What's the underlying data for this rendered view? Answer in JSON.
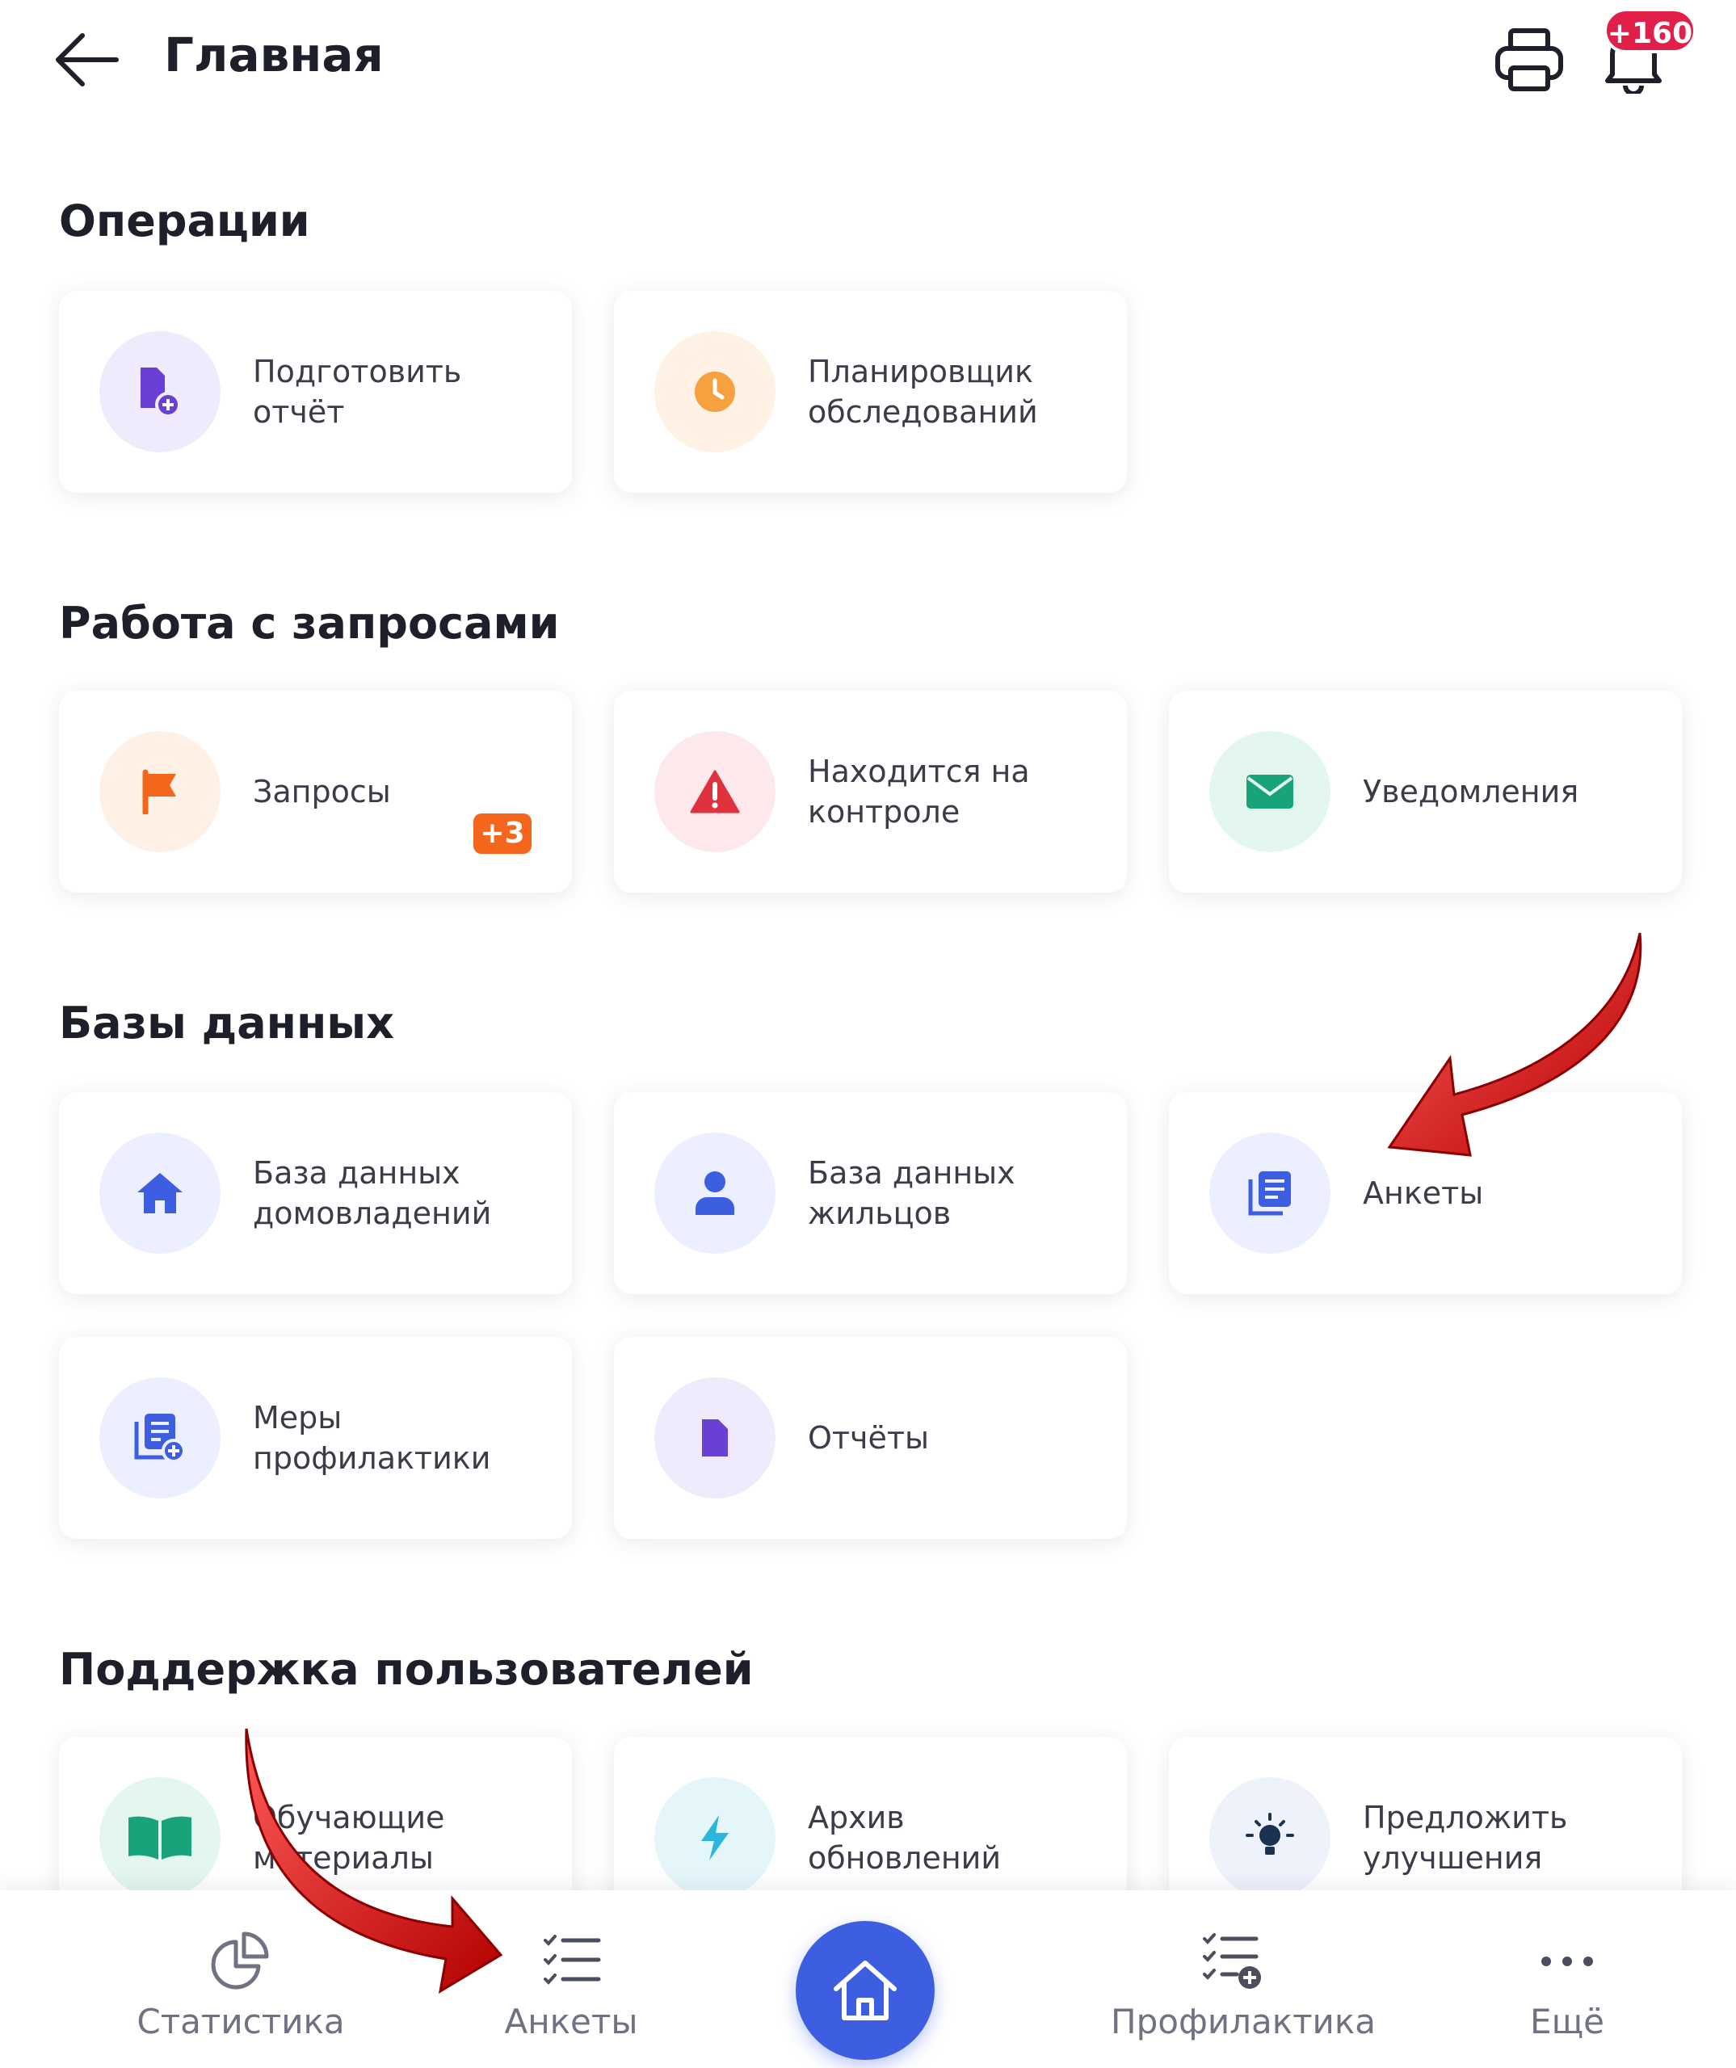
{
  "header": {
    "title": "Главная",
    "notification_badge": "+160"
  },
  "sections": {
    "operations": {
      "title": "Операции",
      "cards": [
        {
          "label": "Подготовить отчёт",
          "icon": "document-add-icon"
        },
        {
          "label": "Планировщик обследований",
          "icon": "clock-icon"
        }
      ]
    },
    "requests": {
      "title": "Работа с запросами",
      "cards": [
        {
          "label": "Запросы",
          "icon": "flag-icon",
          "badge": "+3"
        },
        {
          "label": "Находится на контроле",
          "icon": "warning-icon"
        },
        {
          "label": "Уведомления",
          "icon": "envelope-icon"
        }
      ]
    },
    "databases": {
      "title": "Базы данных",
      "cards": [
        {
          "label": "База данных домовладений",
          "icon": "house-icon"
        },
        {
          "label": "База данных жильцов",
          "icon": "person-icon"
        },
        {
          "label": "Анкеты",
          "icon": "forms-icon"
        },
        {
          "label": "Меры профилактики",
          "icon": "list-add-icon"
        },
        {
          "label": "Отчёты",
          "icon": "file-icon"
        }
      ]
    },
    "support": {
      "title": "Поддержка пользователей",
      "cards": [
        {
          "label": "Обучающие материалы",
          "icon": "book-icon"
        },
        {
          "label": "Архив обновлений",
          "icon": "lightning-icon"
        },
        {
          "label": "Предложить улучшения",
          "icon": "lightbulb-icon"
        }
      ]
    }
  },
  "bottom_nav": {
    "items": [
      {
        "label": "Статистика",
        "icon": "pie-chart-icon"
      },
      {
        "label": "Анкеты",
        "icon": "checklist-icon"
      },
      {
        "label": "Профилактика",
        "icon": "checklist-add-icon"
      },
      {
        "label": "Ещё",
        "icon": "more-icon"
      }
    ],
    "home_icon": "home-icon"
  },
  "colors": {
    "accent": "#3d5ee1",
    "badge_red": "#e21f4a",
    "badge_orange": "#f4661b"
  }
}
